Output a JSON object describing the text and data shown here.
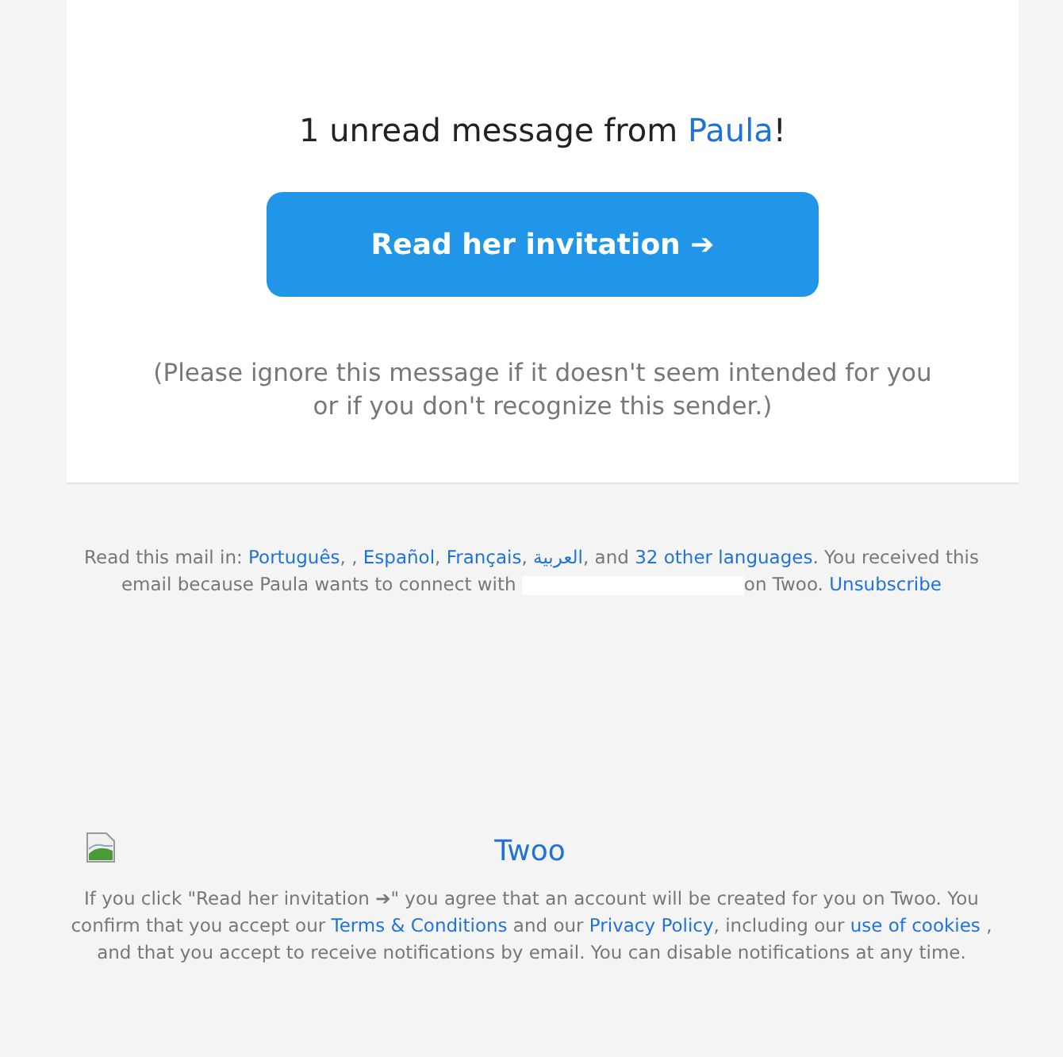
{
  "card": {
    "heading": [
      {
        "kind": "text",
        "text": "1 unread message from "
      },
      {
        "kind": "link",
        "text": "Paula"
      },
      {
        "kind": "text",
        "text": "!"
      }
    ],
    "button": {
      "label": "Read her invitation ➔"
    },
    "note": "(Please ignore this message if it doesn't seem intended for you or if you don't recognize this sender.)"
  },
  "footer": {
    "languages": [
      {
        "kind": "text",
        "text": "Read this mail in: "
      },
      {
        "kind": "link",
        "text": "Português"
      },
      {
        "kind": "text",
        "text": ", , "
      },
      {
        "kind": "link",
        "text": "Español"
      },
      {
        "kind": "text",
        "text": ", "
      },
      {
        "kind": "link",
        "text": "Français"
      },
      {
        "kind": "text",
        "text": ", "
      },
      {
        "kind": "link",
        "text": "العربية"
      },
      {
        "kind": "text",
        "text": ", and "
      },
      {
        "kind": "link",
        "text": "32 other languages"
      },
      {
        "kind": "text",
        "text": ". You received this email because Paula wants to connect with "
      },
      {
        "kind": "redaction"
      },
      {
        "kind": "text",
        "text": "on Twoo. "
      },
      {
        "kind": "link",
        "text": "Unsubscribe"
      }
    ],
    "logo_alt": "Twoo",
    "legal": [
      {
        "kind": "text",
        "text": "If you click \"Read her invitation ➔\" you agree that an account will be created for you on Twoo. You confirm that you accept our "
      },
      {
        "kind": "link",
        "text": "Terms & Conditions"
      },
      {
        "kind": "text",
        "text": " and our "
      },
      {
        "kind": "link",
        "text": "Privacy Policy"
      },
      {
        "kind": "text",
        "text": ", including our "
      },
      {
        "kind": "link",
        "text": "use of cookies"
      },
      {
        "kind": "text",
        "text": " , and that you accept to receive notifications by email. You can disable notifications at any time."
      }
    ]
  }
}
